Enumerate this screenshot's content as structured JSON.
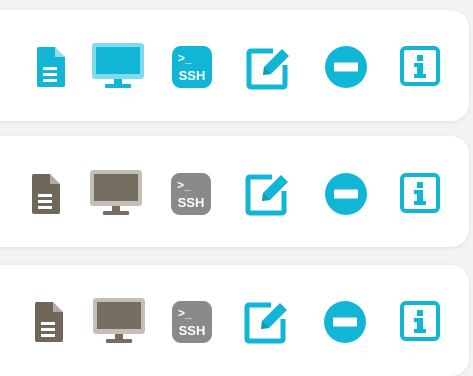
{
  "colors": {
    "accent": "#11b6d6",
    "inactive_dark": "#6f6759",
    "inactive_gray": "#8a8a8a",
    "monitor_gray_body": "#c5c0b6",
    "monitor_gray_screen": "#766e61",
    "monitor_cyan_body": "#7fdcec",
    "monitor_cyan_screen": "#11b6d6"
  },
  "rows": [
    {
      "state": "active",
      "icons": [
        "document-icon",
        "monitor-icon",
        "ssh-terminal-icon",
        "edit-icon",
        "remove-icon",
        "info-icon"
      ],
      "ssh_prompt": ">_",
      "ssh_text": "SSH"
    },
    {
      "state": "inactive",
      "icons": [
        "document-icon",
        "monitor-icon",
        "ssh-terminal-icon",
        "edit-icon",
        "remove-icon",
        "info-icon"
      ],
      "ssh_prompt": ">_",
      "ssh_text": "SSH"
    },
    {
      "state": "inactive",
      "icons": [
        "document-icon",
        "monitor-icon",
        "ssh-terminal-icon",
        "edit-icon",
        "remove-icon",
        "info-icon"
      ],
      "ssh_prompt": ">_",
      "ssh_text": "SSH"
    }
  ]
}
